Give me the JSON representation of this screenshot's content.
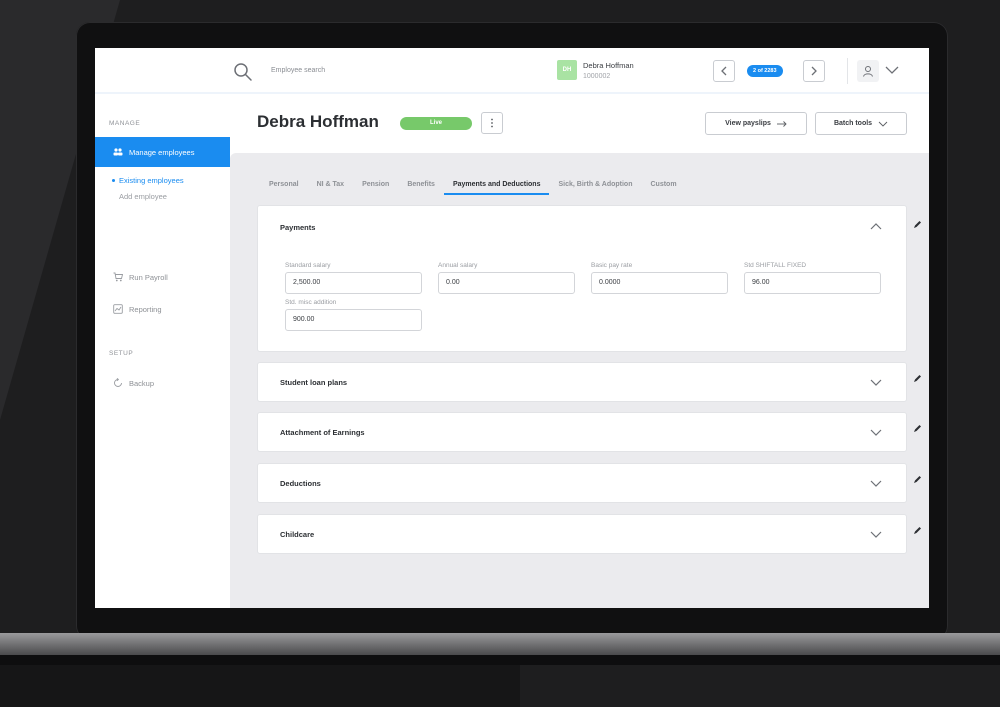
{
  "header": {
    "search_placeholder": "Employee search",
    "employee": {
      "initials": "DH",
      "name": "Debra Hoffman",
      "id": "1000002"
    },
    "counter": "2 of 2283"
  },
  "sidebar": {
    "manage_label": "MANAGE",
    "setup_label": "SETUP",
    "items": {
      "manage_employees": "Manage employees",
      "existing_employees": "Existing employees",
      "add_employee": "Add employee",
      "run_payroll": "Run Payroll",
      "reporting": "Reporting",
      "backup": "Backup"
    }
  },
  "page": {
    "title": "Debra Hoffman",
    "status": "Live",
    "view_payslips": "View payslips",
    "batch_tools": "Batch tools"
  },
  "tabs": [
    "Personal",
    "NI & Tax",
    "Pension",
    "Benefits",
    "Payments and Deductions",
    "Sick, Birth & Adoption",
    "Custom"
  ],
  "payments": {
    "title": "Payments",
    "fields": [
      {
        "label": "Standard salary",
        "value": "2,500.00"
      },
      {
        "label": "Annual salary",
        "value": "0.00"
      },
      {
        "label": "Basic pay rate",
        "value": "0.0000"
      },
      {
        "label": "Std SHIFTALL FIXED",
        "value": "96.00"
      },
      {
        "label": "Std. misc addition",
        "value": "900.00"
      }
    ]
  },
  "panels": {
    "student_loan": "Student loan plans",
    "attachment": "Attachment of Earnings",
    "deductions": "Deductions",
    "childcare": "Childcare"
  },
  "colors": {
    "accent": "#1a8cf0",
    "live": "#77c96a",
    "avatar": "#a9e3a3"
  }
}
